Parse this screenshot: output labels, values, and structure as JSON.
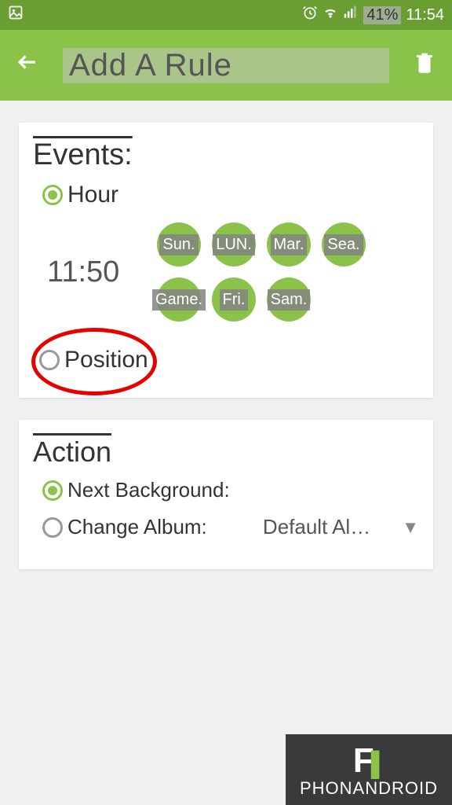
{
  "statusbar": {
    "battery": "41%",
    "time": "11:54"
  },
  "appbar": {
    "title": "Add A Rule"
  },
  "events": {
    "title": "Events:",
    "hour_label": "Hour",
    "time": "11:50",
    "days": [
      "Sun.",
      "LUN.",
      "Mar.",
      "Sea.",
      "Game.",
      "Fri.",
      "Sam."
    ],
    "position_label": "Position"
  },
  "action": {
    "title": "Action",
    "next_bg_label": "Next Background:",
    "change_album_label": "Change Album:",
    "album_value": "Default Al…"
  },
  "watermark": {
    "text": "PHONANDROID"
  },
  "colors": {
    "accent": "#8bc34a",
    "statusbar": "#6a9e32",
    "annotation": "#e60000"
  }
}
